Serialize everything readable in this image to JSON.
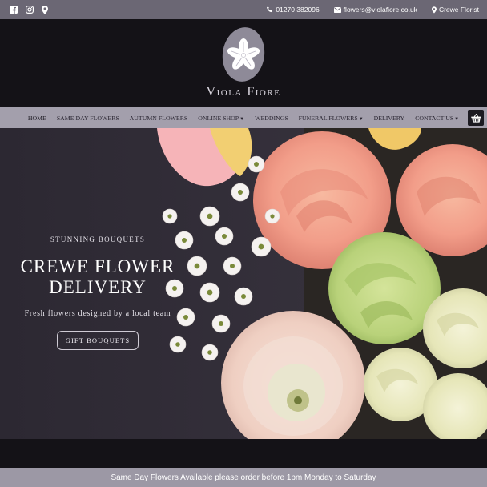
{
  "topbar": {
    "social": [
      {
        "icon": "facebook-icon"
      },
      {
        "icon": "instagram-icon"
      },
      {
        "icon": "map-pin-icon"
      }
    ],
    "phone": "01270 382096",
    "email": "flowers@violafiore.co.uk",
    "location": "Crewe Florist"
  },
  "header": {
    "brand": "Viola Fiore"
  },
  "nav": {
    "items": [
      {
        "label": "Home",
        "dropdown": false
      },
      {
        "label": "Same Day Flowers",
        "dropdown": false
      },
      {
        "label": "Autumn Flowers",
        "dropdown": false
      },
      {
        "label": "Online Shop",
        "dropdown": true
      },
      {
        "label": "Weddings",
        "dropdown": false
      },
      {
        "label": "Funeral Flowers",
        "dropdown": true
      },
      {
        "label": "Delivery",
        "dropdown": false
      },
      {
        "label": "Contact Us",
        "dropdown": true
      }
    ],
    "basket_icon": "basket-icon"
  },
  "hero": {
    "kicker": "STUNNING BOUQUETS",
    "title_line1": "CREWE FLOWER",
    "title_line2": "DELIVERY",
    "subtitle": "Fresh flowers designed by a local team",
    "button": "GIFT BOUQUETS"
  },
  "notice": {
    "text": "Same Day Flowers Available please order before 1pm Monday to Saturday"
  },
  "colors": {
    "topbar": "#6b6774",
    "header": "#141217",
    "nav": "#a39fac",
    "notice": "#9c98a5",
    "logo_circle": "#8e8a98"
  }
}
